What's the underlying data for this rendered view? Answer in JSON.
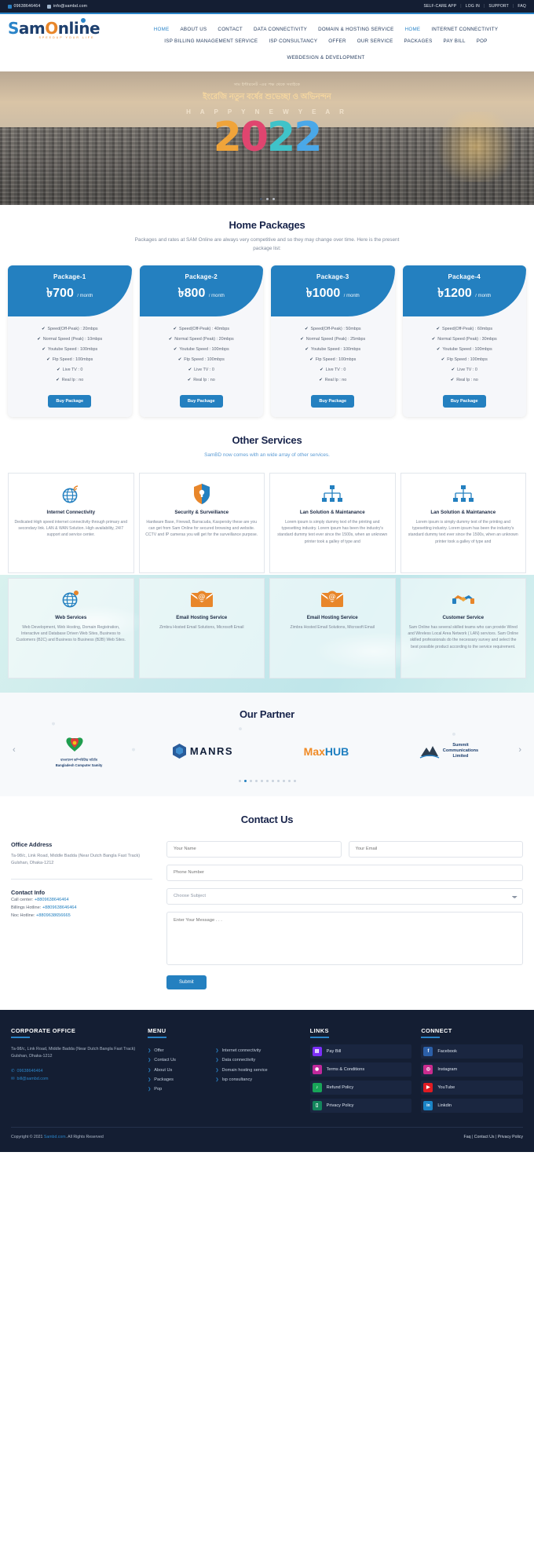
{
  "topbar": {
    "phone": "09638646464",
    "email": "info@sambd.com",
    "links": [
      "SELF-CARE APP",
      "LOG IN",
      "SUPPORT",
      "FAQ"
    ],
    "sep": "|"
  },
  "brand": {
    "s": "S",
    "am": "am",
    "o": "O",
    "nline": "nline",
    "tagline": "SPEEDUP YOUR LIFE"
  },
  "nav": {
    "row1": [
      {
        "label": "HOME",
        "active": true
      },
      {
        "label": "ABOUT US",
        "active": false
      },
      {
        "label": "CONTACT",
        "active": false
      },
      {
        "label": "DATA CONNECTIVITY",
        "active": false
      },
      {
        "label": "DOMAIN & HOSTING SERVICE",
        "active": false
      },
      {
        "label": "HOME",
        "active": true
      },
      {
        "label": "INTERNET CONNECTIVITY",
        "active": false
      }
    ],
    "row2": [
      {
        "label": "ISP BILLING MANAGEMENT SERVICE",
        "active": false
      },
      {
        "label": "ISP CONSULTANCY",
        "active": false
      },
      {
        "label": "OFFER",
        "active": false
      },
      {
        "label": "OUR SERVICE",
        "active": false
      },
      {
        "label": "PACKAGES",
        "active": false
      },
      {
        "label": "PAY BILL",
        "active": false
      },
      {
        "label": "POP",
        "active": false
      },
      {
        "label": "WEBDESIGN & DEVELOPMENT",
        "active": false
      }
    ]
  },
  "hero": {
    "bangla_small": "সাম ইন্টারনেট -এর পক্ষ থেকে সবাইকে",
    "bangla_big": "ইংরেজি নতুন বর্ষের শুভেচ্ছা ও অভিনন্দন",
    "happy_new_year": "H A P P Y   N E W   Y E A R",
    "year": "2022",
    "dots": 3,
    "active_dot": 0
  },
  "packages_section": {
    "title": "Home Packages",
    "subtitle": "Packages and rates at SAM Online are always very competitive and so they may change over time. Here is the present package list:",
    "buy_label": "Buy Package",
    "currency": "৳",
    "per": "/ month",
    "cards": [
      {
        "name": "Package-1",
        "price": "700",
        "features": [
          "Speed(Off-Peak) : 20mbps",
          "Normal Speed (Peak) : 10mbps",
          "Youtube Speed : 100mbps",
          "Ftp Speed : 100mbps",
          "Live TV : 0",
          "Real Ip : no"
        ]
      },
      {
        "name": "Package-2",
        "price": "800",
        "features": [
          "Speed(Off-Peak) : 40mbps",
          "Normal Speed (Peak) : 20mbps",
          "Youtube Speed : 100mbps",
          "Ftp Speed : 100mbps",
          "Live TV : 0",
          "Real Ip : no"
        ]
      },
      {
        "name": "Package-3",
        "price": "1000",
        "features": [
          "Speed(Off-Peak) : 50mbps",
          "Normal Speed (Peak) : 25mbps",
          "Youtube Speed : 100mbps",
          "Ftp Speed : 100mbps",
          "Live TV : 0",
          "Real Ip : no"
        ]
      },
      {
        "name": "Package-4",
        "price": "1200",
        "features": [
          "Speed(Off-Peak) : 60mbps",
          "Normal Speed (Peak) : 30mbps",
          "Youtube Speed : 100mbps",
          "Ftp Speed : 100mbps",
          "Live TV : 0",
          "Real Ip : no"
        ]
      }
    ]
  },
  "services_section": {
    "title": "Other Services",
    "subtitle": "SamBD now comes with an wide array of other services.",
    "cards": [
      {
        "icon": "globe-signal-icon",
        "title": "Internet Connectivity",
        "desc": "Dedicated High speed internet connectivity through primary and secondary link. LAN & WAN Solution. High availability, 24/7 support and service center."
      },
      {
        "icon": "shield-icon",
        "title": "Security & Surveillance",
        "desc": "Hardware Base, Firewall, Barracuda, Kaspersky these are you can get from Sam Online for secured browsing and website. CCTV and IP cameras you will get for the surveillance purpose."
      },
      {
        "icon": "network-icon",
        "title": "Lan Solution & Maintanance",
        "desc": "Lorem ipsum is simply dummy text of the printing and typesetting industry. Lorem ipsum has been the industry's standard dummy text ever since the 1500s, when an unknown printer took a galley of type and"
      },
      {
        "icon": "network-icon",
        "title": "Lan Solution & Maintanance",
        "desc": "Lorem ipsum is simply dummy text of the printing and typesetting industry. Lorem ipsum has been the industry's standard dummy text ever since the 1500s, when an unknown printer took a galley of type and"
      },
      {
        "icon": "globe-pin-icon",
        "title": "Web Services",
        "desc": "Web Development, Web Hosting, Domain Registration, Interactive and Database Driven Web Sites, Business to Customers (B2C) and Business to Business (B2B) Web Sites."
      },
      {
        "icon": "email-icon",
        "title": "Email Hosting Service",
        "desc": "Zimbra Hosted Email Solutions, Microsoft Email"
      },
      {
        "icon": "email-icon",
        "title": "Email Hosting Service",
        "desc": "Zimbra Hosted Email Solutions, Microsoft Email"
      },
      {
        "icon": "handshake-icon",
        "title": "Customer Service",
        "desc": "Sam Online has several skilled teams who can provide Wired and Wireless Local Area Network ( LAN) services. Sam Online skilled professionals do the necessary survey and select the best possible product according to the service requirement."
      }
    ]
  },
  "partner_section": {
    "title": "Our Partner",
    "items": [
      {
        "name": "bangladesh-computer-samity",
        "line1": "বাংলাদেশ কম্পিউটার সমিতি",
        "line2": "Bangladesh Computer Samity"
      },
      {
        "name": "manrs",
        "label": "MANRS"
      },
      {
        "name": "maxhub",
        "label_a": "Max",
        "label_b": "HUB"
      },
      {
        "name": "summit-communications",
        "label": "Summit\nCommunications\nLimited"
      }
    ],
    "dots_count": 11,
    "active_dot": 1,
    "prev": "‹",
    "next": "›"
  },
  "contact_section": {
    "title": "Contact Us",
    "office_heading": "Office Address",
    "office_address": "Ta-98/c, Link Road, Middle Badda (Near Dutch Bangla Fast Track) Gulshan, Dhaka-1212",
    "contact_heading": "Contact Info",
    "call_center_label": "Call center:",
    "call_center_value": "+8809638646464",
    "billing_label": "Billings Hotline:",
    "billing_value": "+8809638646464",
    "noc_label": "Noc Hotline:",
    "noc_value": "+8809638656665",
    "form": {
      "name_placeholder": "Your Name",
      "email_placeholder": "Your Email",
      "phone_placeholder": "Phone Number",
      "subject_placeholder": "Choose Subject",
      "message_placeholder": "Enter Your Message . . .",
      "submit_label": "Submit",
      "name_value": "",
      "email_value": "",
      "phone_value": "",
      "message_value": ""
    }
  },
  "footer": {
    "corporate": {
      "heading": "CORPORATE OFFICE",
      "address": "Ta-98/c, Link Road, Middle Badda (Near Dutch Bangla Fast Track) Gulshan, Dhaka-1212",
      "phone": "09638646464",
      "email": "bill@sambd.com"
    },
    "menu": {
      "heading": "MENU",
      "col1": [
        "Offer",
        "Contact Us",
        "About Us",
        "Packages",
        "Pop"
      ],
      "col2": [
        "Internet connectivity",
        "Data connectivity",
        "Domain hosting service",
        "Isp consultancy"
      ]
    },
    "links": {
      "heading": "LINKS",
      "items": [
        {
          "label": "Pay Bill",
          "icon": "payment-card-icon",
          "color": "#7b2ff7"
        },
        {
          "label": "Terms & Conditions",
          "icon": "badge-icon",
          "color": "#c0289b"
        },
        {
          "label": "Refund Policy",
          "icon": "headset-icon",
          "color": "#18a558"
        },
        {
          "label": "Privacy Policy",
          "icon": "document-icon",
          "color": "#13855c"
        }
      ]
    },
    "connect": {
      "heading": "CONNECT",
      "items": [
        {
          "label": "Facebook",
          "icon": "facebook-icon",
          "color": "#2b5fa8",
          "glyph": "f"
        },
        {
          "label": "Instagram",
          "icon": "instagram-icon",
          "color": "#c92b8e",
          "glyph": "◉"
        },
        {
          "label": "YouTube",
          "icon": "youtube-icon",
          "color": "#e01b22",
          "glyph": "▶"
        },
        {
          "label": "Linkdin",
          "icon": "linkedin-icon",
          "color": "#1a84c7",
          "glyph": "in"
        }
      ]
    },
    "bottom": {
      "copyright_pre": "Copyright © 2021 ",
      "copyright_link": "Sambd.com",
      "copyright_post": ". All Rights Reserved",
      "right_links": [
        "Faq",
        "Contact Us",
        "Privacy Policy"
      ],
      "sep": "|"
    }
  },
  "colors": {
    "brand_blue": "#2480c0",
    "dark_navy": "#141e33",
    "heading_navy": "#17234a",
    "orange": "#e8862a"
  }
}
